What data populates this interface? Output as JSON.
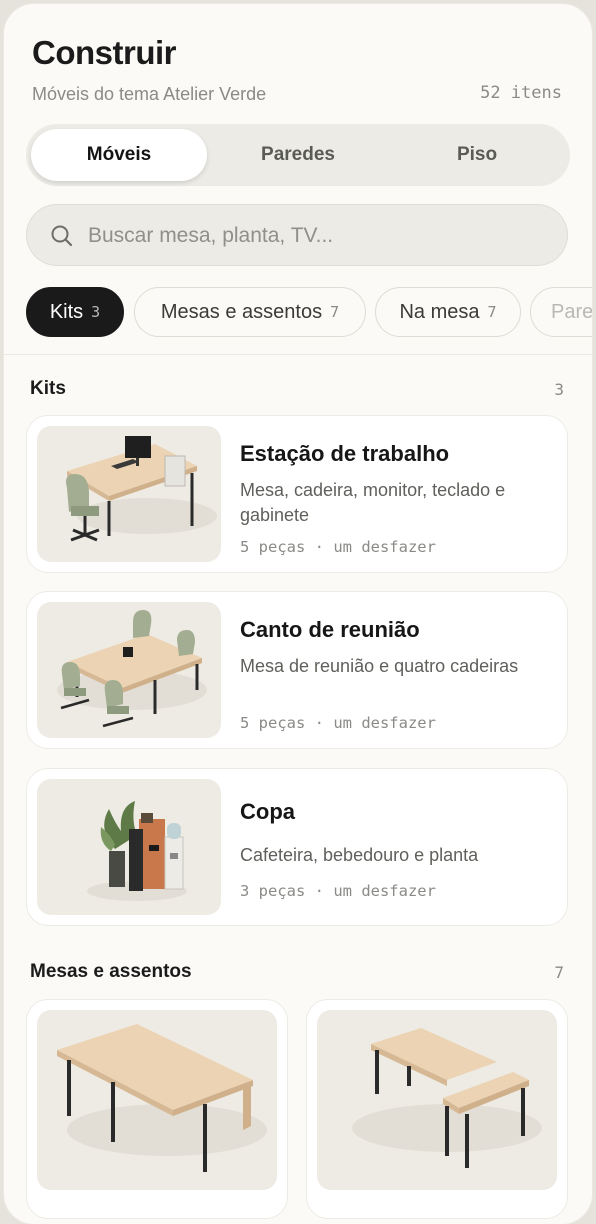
{
  "header": {
    "title": "Construir",
    "subtitle": "Móveis do tema Atelier Verde",
    "total": "52 itens"
  },
  "tabs": [
    {
      "label": "Móveis",
      "active": true
    },
    {
      "label": "Paredes",
      "active": false
    },
    {
      "label": "Piso",
      "active": false
    }
  ],
  "search": {
    "placeholder": "Buscar mesa, planta, TV..."
  },
  "chips": [
    {
      "label": "Kits",
      "count": "3",
      "active": true
    },
    {
      "label": "Mesas e assentos",
      "count": "7",
      "active": false
    },
    {
      "label": "Na mesa",
      "count": "7",
      "active": false
    },
    {
      "label": "Pare",
      "count": "",
      "active": false
    }
  ],
  "sections": {
    "kits": {
      "title": "Kits",
      "count": "3",
      "items": [
        {
          "title": "Estação de trabalho",
          "desc": "Mesa, cadeira, monitor, teclado e gabinete",
          "meta": "5 peças · um desfazer",
          "icon": "workstation-illustration"
        },
        {
          "title": "Canto de reunião",
          "desc": "Mesa de reunião e quatro cadeiras",
          "meta": "5 peças · um desfazer",
          "icon": "meeting-table-illustration"
        },
        {
          "title": "Copa",
          "desc": "Cafeteira, bebedouro e planta",
          "meta": "3 peças · um desfazer",
          "icon": "pantry-illustration"
        }
      ]
    },
    "tables": {
      "title": "Mesas e assentos",
      "count": "7",
      "items": [
        {
          "icon": "desk-illustration"
        },
        {
          "icon": "l-desk-illustration"
        }
      ]
    }
  },
  "colors": {
    "accent": "#1a1a1a",
    "background": "#fbfaf7",
    "wood": "#e8cfae"
  }
}
